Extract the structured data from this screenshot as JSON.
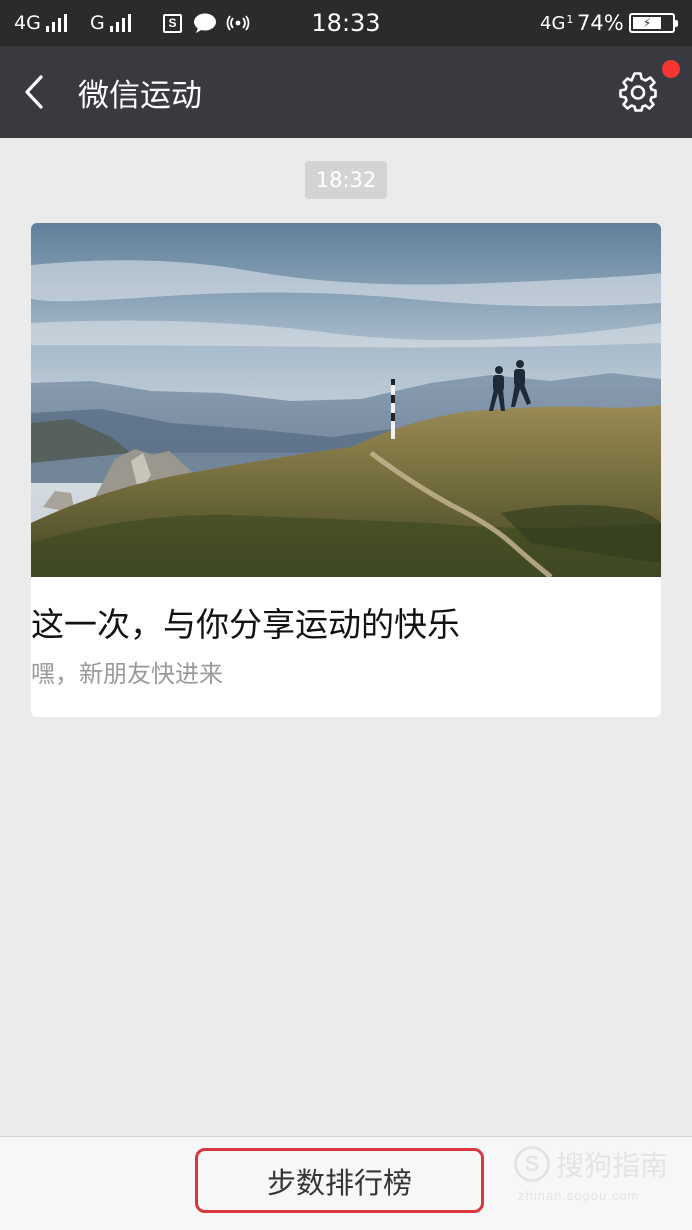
{
  "status_bar": {
    "network_1": "4G",
    "network_2": "G",
    "s_badge": "S",
    "time": "18:33",
    "network_3": "4G",
    "network_3_sub": "1",
    "battery_percent": "74%",
    "battery_level": 0.74
  },
  "nav": {
    "title": "微信运动",
    "back_icon": "chevron-left-icon",
    "settings_icon": "gear-icon",
    "has_notification_dot": true
  },
  "message": {
    "timestamp": "18:32",
    "card": {
      "title": "这一次，与你分享运动的快乐",
      "subtitle": "嘿，新朋友快进来"
    }
  },
  "bottom": {
    "rank_button_label": "步数排行榜"
  },
  "watermark": {
    "logo_letter": "S",
    "text": "搜狗指南",
    "url": "zhinan.sogou.com"
  },
  "colors": {
    "status_bar_bg": "#2b2b2b",
    "nav_bg": "#393a3f",
    "page_bg": "#ebebeb",
    "notification_dot": "#f43530",
    "highlight_border": "#d9363e"
  }
}
